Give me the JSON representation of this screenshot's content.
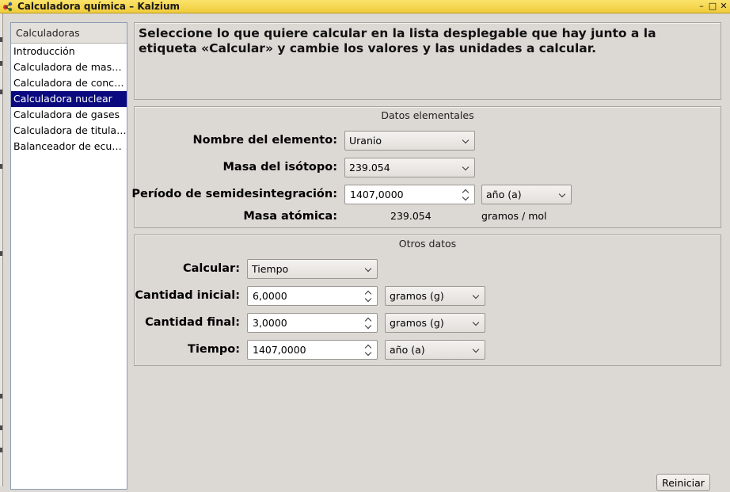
{
  "window": {
    "title": "Calculadora química – Kalzium",
    "controls": {
      "minimize": "–",
      "maximize": "□",
      "close": "✕"
    },
    "colors": {
      "titlebar": "#f0cc3c",
      "selection": "#0a0a7e"
    }
  },
  "sidebar": {
    "header": "Calculadoras",
    "items": [
      {
        "label": "Introducción"
      },
      {
        "label": "Calculadora de masa molecular"
      },
      {
        "label": "Calculadora de concentración"
      },
      {
        "label": "Calculadora nuclear"
      },
      {
        "label": "Calculadora de gases"
      },
      {
        "label": "Calculadora de titulación"
      },
      {
        "label": "Balanceador de ecuaciones"
      }
    ],
    "selected_index": 3
  },
  "description": "Seleccione lo que quiere calcular en la lista desplegable que hay junto a la etiqueta «Calcular» y cambie los valores y las unidades a calcular.",
  "elemental": {
    "title": "Datos elementales",
    "element_name_label": "Nombre del elemento:",
    "element_name_value": "Uranio",
    "isotope_mass_label": "Masa del isótopo:",
    "isotope_mass_value": "239.054",
    "half_life_label": "Período de semidesintegración:",
    "half_life_value": "1407,0000",
    "half_life_unit": "año (a)",
    "atomic_mass_label": "Masa atómica:",
    "atomic_mass_value": "239.054",
    "atomic_mass_unit": "gramos / mol"
  },
  "other": {
    "title": "Otros datos",
    "calculate_label": "Calcular:",
    "calculate_value": "Tiempo",
    "initial_label": "Cantidad inicial:",
    "initial_value": "6,0000",
    "initial_unit": "gramos (g)",
    "final_label": "Cantidad final:",
    "final_value": "3,0000",
    "final_unit": "gramos (g)",
    "time_label": "Tiempo:",
    "time_value": "1407,0000",
    "time_unit": "año (a)"
  },
  "buttons": {
    "reset": "Reiniciar"
  }
}
